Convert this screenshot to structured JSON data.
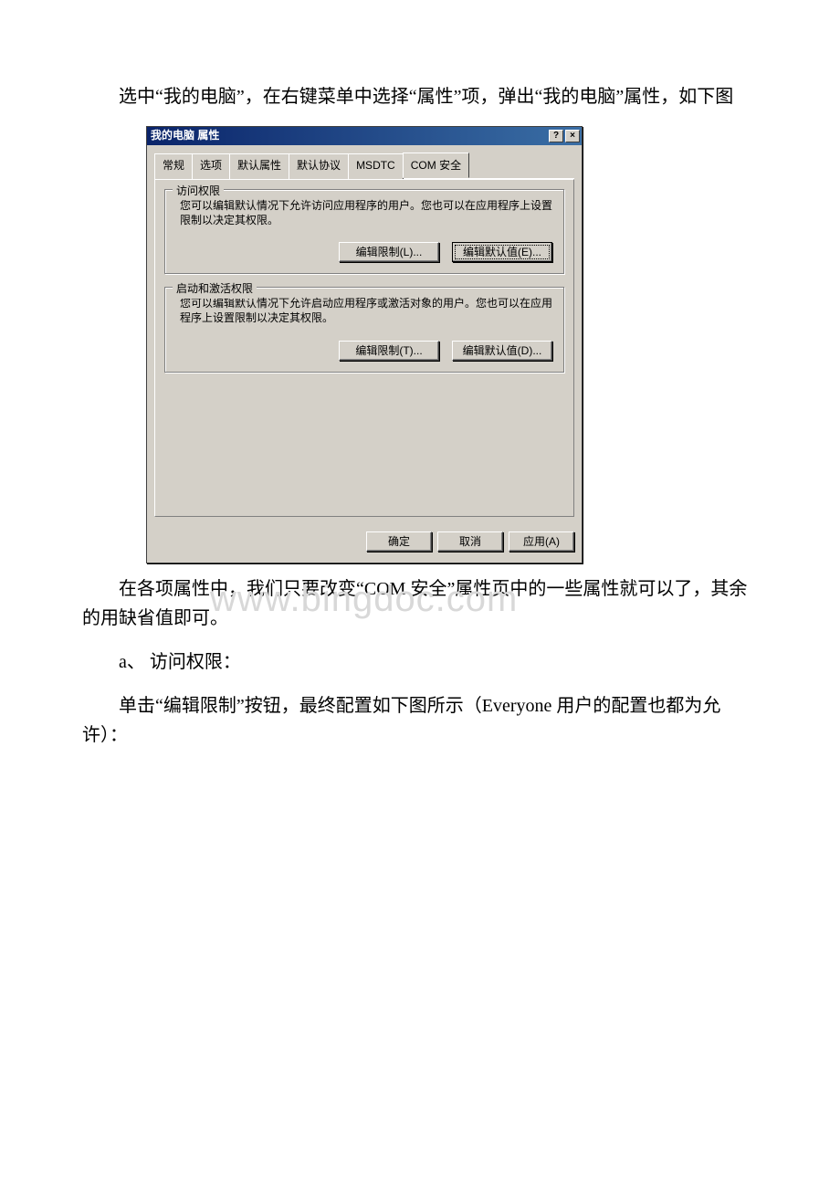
{
  "doc": {
    "p1": "选中“我的电脑”，在右键菜单中选择“属性”项，弹出“我的电脑”属性，如下图",
    "p2": "在各项属性中，我们只要改变“COM 安全”属性页中的一些属性就可以了，其余的用缺省值即可。",
    "p3": "a、 访问权限：",
    "p4": " 单击“编辑限制”按钮，最终配置如下图所示（Everyone 用户的配置也都为允许）："
  },
  "dialog": {
    "title": "我的电脑 属性",
    "help": "?",
    "close": "×",
    "tabs": {
      "general": "常规",
      "options": "选项",
      "default_props": "默认属性",
      "default_protocols": "默认协议",
      "msdtc": "MSDTC",
      "com_security": "COM 安全"
    },
    "group1": {
      "title": "访问权限",
      "text": "您可以编辑默认情况下允许访问应用程序的用户。您也可以在应用程序上设置限制以决定其权限。",
      "btn_limit": "编辑限制(L)...",
      "btn_default": "编辑默认值(E)..."
    },
    "group2": {
      "title": "启动和激活权限",
      "text": "您可以编辑默认情况下允许启动应用程序或激活对象的用户。您也可以在应用程序上设置限制以决定其权限。",
      "btn_limit": "编辑限制(T)...",
      "btn_default": "编辑默认值(D)..."
    },
    "footer": {
      "ok": "确定",
      "cancel": "取消",
      "apply": "应用(A)"
    }
  },
  "watermark": "www.bingdoc.com"
}
